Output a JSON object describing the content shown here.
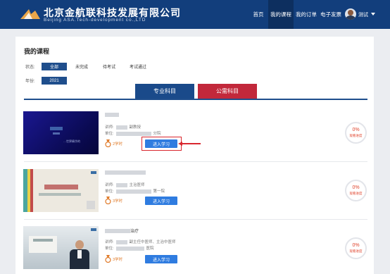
{
  "header": {
    "logo_cn": "北京金航联科技发展有限公司",
    "logo_en": "Beijing ASA.Tech-development co.,LTD",
    "nav": [
      {
        "label": "首页"
      },
      {
        "label": "我的课程"
      },
      {
        "label": "我的订单"
      },
      {
        "label": "电子发票"
      }
    ],
    "active_nav": "我的课程",
    "user_name": "测试"
  },
  "page": {
    "title": "我的课程",
    "status_label": "状态:",
    "status_options": [
      "全部",
      "未完成",
      "待考试",
      "考试通过"
    ],
    "status_selected": "全部",
    "year_label": "年份:",
    "year_value": "2021"
  },
  "category_tabs": [
    "专业科目",
    "公需科目"
  ],
  "category_selected": "专业科目",
  "courses": [
    {
      "lecturer_label": "讲师:",
      "lecturer_title": "副教授",
      "unit_label": "单位:",
      "unit_suffix": "分院",
      "hours": "2学时",
      "button": "进入学习",
      "progress": "0%",
      "progress_label": "观看进度",
      "thumb_text": "…世界精华的"
    },
    {
      "lecturer_label": "讲师:",
      "lecturer_title": "主治医师",
      "unit_label": "单位:",
      "unit_suffix": "第一院",
      "hours": "3学时",
      "button": "进入学习",
      "progress": "0%",
      "progress_label": "观看进度",
      "thumb_text": ""
    },
    {
      "name_suffix": "治疗",
      "lecturer_label": "讲师:",
      "lecturer_title": "副主任中医师、主治中医师",
      "unit_label": "单位:",
      "unit_suffix": "医院",
      "hours": "3学时",
      "button": "进入学习",
      "progress": "0%",
      "progress_label": "观看进度",
      "thumb_text": ""
    }
  ],
  "colors": {
    "header_bg": "#123e7c",
    "accent_blue": "#2f7ce0",
    "tab_pro": "#1a4a8a",
    "tab_pub": "#c2283b",
    "annotation_red": "#d9272e",
    "progress_red": "#e0452e",
    "hours_orange": "#e07b2a"
  }
}
